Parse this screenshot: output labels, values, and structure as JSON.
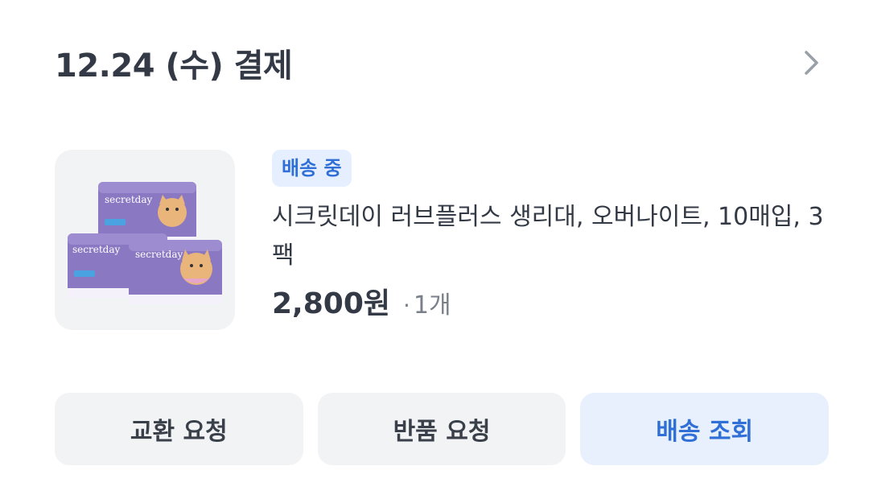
{
  "header": {
    "title": "12.24 (수) 결제",
    "chevron_icon": "chevron-right-icon"
  },
  "order": {
    "status_badge": "배송 중",
    "product_name": "시크릿데이 러브플러스 생리대, 오버나이트, 10매입, 3팩",
    "price": "2,800원",
    "qty_separator": "·",
    "quantity": "1개",
    "image_brand_text": "secretday"
  },
  "actions": {
    "exchange_label": "교환 요청",
    "return_label": "반품 요청",
    "track_label": "배송 조회"
  },
  "colors": {
    "accent": "#2f6fd6",
    "badge_bg": "#e6efff",
    "button_bg": "#f2f3f5",
    "primary_button_bg": "#e8f0fe",
    "text": "#333a45",
    "muted_text": "#7a808a",
    "package_purple": "#8a78c2"
  }
}
